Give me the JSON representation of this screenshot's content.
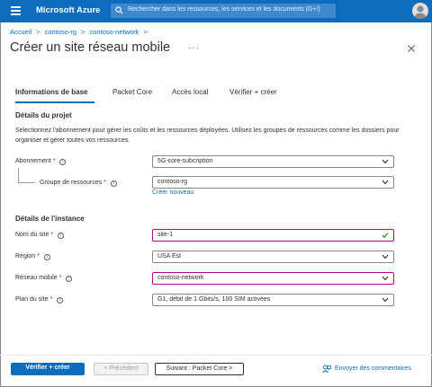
{
  "topbar": {
    "brand": "Microsoft Azure",
    "search_placeholder": "Rechercher dans les ressources, les services et les documents (G+/)"
  },
  "breadcrumb": [
    "Accueil",
    "contoso-rg",
    "contoso-network"
  ],
  "page": {
    "title": "Créer un site réseau mobile",
    "more": "···"
  },
  "tabs": [
    "Informations de base",
    "Packet Core",
    "Accès local",
    "Vérifier + créer"
  ],
  "project": {
    "heading": "Détails du projet",
    "description": "Sélectionnez l'abonnement pour gérer les coûts et les ressources déployées. Utilisez les groupes de ressources comme les dossiers pour organiser et gérer toutes vos ressources.",
    "subscription": {
      "label": "Abonnement",
      "value": "5G-core-subcription"
    },
    "resource_group": {
      "label": "Groupe de ressources",
      "value": "contoso-rg",
      "create_link": "Créer nouveau"
    }
  },
  "instance": {
    "heading": "Détails de l'instance",
    "site_name": {
      "label": "Nom du site",
      "value": "site-1"
    },
    "region": {
      "label": "Région",
      "value": "USA Est"
    },
    "mobile_network": {
      "label": "Réseau mobile",
      "value": "contoso-network"
    },
    "site_plan": {
      "label": "Plan du site",
      "value": "G1, débit de 1 Gbits/s, 100 SIM activées"
    }
  },
  "footer": {
    "review_create": "Vérifier + créer",
    "previous": "< Précédent",
    "next": "Suivant : Packet Core >",
    "feedback": "Envoyer des commentaires"
  },
  "required_marker": "*",
  "info_marker": "i",
  "colors": {
    "accent": "#0f6cbd",
    "valid_border": "#b4009e",
    "valid_check": "#107c10",
    "required": "#a4262c"
  }
}
